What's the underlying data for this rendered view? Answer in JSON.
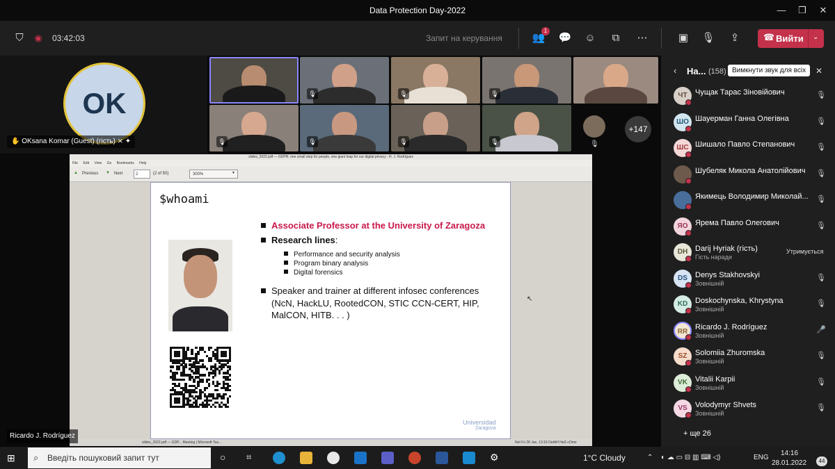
{
  "window": {
    "title": "Data Protection Day-2022",
    "minimize": "—",
    "restore": "❐",
    "close": "✕"
  },
  "callbar": {
    "timer": "03:42:03",
    "request_control": "Запит на керування",
    "people_badge": "1",
    "leave_label": "Вийти",
    "leave_color": "#c4314b"
  },
  "stage": {
    "guest_initials": "OK",
    "guest_label": "OKsana Komar (Guest) (гість)",
    "more_count": "+147",
    "speaker_label": "Ricardo J. Rodríguez"
  },
  "viewer": {
    "title": "slides_2022.pdf — GDPR: one small step for people, one giant leap for our digital privacy - R. J. Rodríguez",
    "menu": [
      "File",
      "Edit",
      "View",
      "Go",
      "Bookmarks",
      "Help"
    ],
    "prev_label": "Previous",
    "next_label": "Next",
    "page_value": "2",
    "page_count": "(2 of 50)",
    "zoom": "300%",
    "taskbar_text": "slides_2022.pdf — GDP...   Meeting | Microsoft Tea...",
    "taskbar_right": "Net   Fri 28 Jan, 13:16   DeAtH HaS cOme"
  },
  "slide": {
    "heading": "$whoami",
    "bullet1": "Associate Professor at the University of Zaragoza",
    "bullet1_color": "#c8184a",
    "bullet2_bold": "Research lines",
    "bullet2_rest": ":",
    "sub1": "Performance and security analysis",
    "sub2": "Program binary analysis",
    "sub3": "Digital forensics",
    "bullet3_line1": "Speaker and trainer at different infosec conferences",
    "bullet3_line2": "(NcN, HackLU, RootedCON, STIC CCN-CERT, HIP,",
    "bullet3_line3": "MalCON, HITB. . . )",
    "logo_line1": "Universidad",
    "logo_line2": "Zaragoza"
  },
  "panel": {
    "title": "На...",
    "count": "(158)",
    "tooltip": "Вимкнути звук для всіх",
    "close": "✕",
    "participants": [
      {
        "initials": "ЧТ",
        "name": "Чущак Тарас Зіновійович",
        "sub": "",
        "status": "",
        "avatar_color": "#d8d0c8",
        "text_color": "#5a4a3a"
      },
      {
        "initials": "ШО",
        "name": "Шауерман Ганна Олегівна",
        "sub": "",
        "status": "",
        "avatar_color": "#d2e6f0",
        "text_color": "#245a78"
      },
      {
        "initials": "ШС",
        "name": "Шишало Павло Степанович",
        "sub": "",
        "status": "",
        "avatar_color": "#f4d7d7",
        "text_color": "#a33a3a"
      },
      {
        "initials": "",
        "name": "Шубеляк Микола Анатолійович",
        "sub": "",
        "status": "",
        "avatar_color": "#6e5a4c",
        "text_color": "#fff"
      },
      {
        "initials": "",
        "name": "Якимець Володимир Миколай...",
        "sub": "",
        "status": "",
        "avatar_color": "#4a6e9c",
        "text_color": "#fff"
      },
      {
        "initials": "ЯО",
        "name": "Ярема Павло Олегович",
        "sub": "",
        "status": "",
        "avatar_color": "#f2d4dc",
        "text_color": "#9c3556"
      },
      {
        "initials": "DH",
        "name": "Darij Hyriak (гість)",
        "sub": "Гість наради",
        "status": "Утримується",
        "avatar_color": "#e8e6d8",
        "text_color": "#5a5a3a"
      },
      {
        "initials": "DS",
        "name": "Denys Stakhovskyi",
        "sub": "Зовнішній",
        "status": "",
        "avatar_color": "#d6e4f4",
        "text_color": "#2a527e"
      },
      {
        "initials": "KD",
        "name": "Doskochynska, Khrystyna",
        "sub": "Зовнішній",
        "status": "",
        "avatar_color": "#d4ece4",
        "text_color": "#2e6e58"
      },
      {
        "initials": "RR",
        "name": "Ricardo J. Rodríguez",
        "sub": "Зовнішній",
        "status": "",
        "avatar_color": "#f2e6d4",
        "text_color": "#8a6434"
      },
      {
        "initials": "SZ",
        "name": "Solomiia Zhuromska",
        "sub": "Зовнішній",
        "status": "",
        "avatar_color": "#f6dccc",
        "text_color": "#9c4a2a"
      },
      {
        "initials": "VK",
        "name": "Vitalii Karpii",
        "sub": "Зовнішній",
        "status": "",
        "avatar_color": "#dcecd8",
        "text_color": "#3e6e34"
      },
      {
        "initials": "VS",
        "name": "Volodymyr Shvets",
        "sub": "Зовнішній",
        "status": "",
        "avatar_color": "#f4d8e4",
        "text_color": "#9a3a64"
      }
    ],
    "more": "+ ще 26"
  },
  "taskbar": {
    "search_placeholder": "Введіть пошуковий запит тут",
    "weather": "1°C  Cloudy",
    "lang": "ENG",
    "time": "14:16",
    "date": "28.01.2022",
    "notif": "44"
  }
}
